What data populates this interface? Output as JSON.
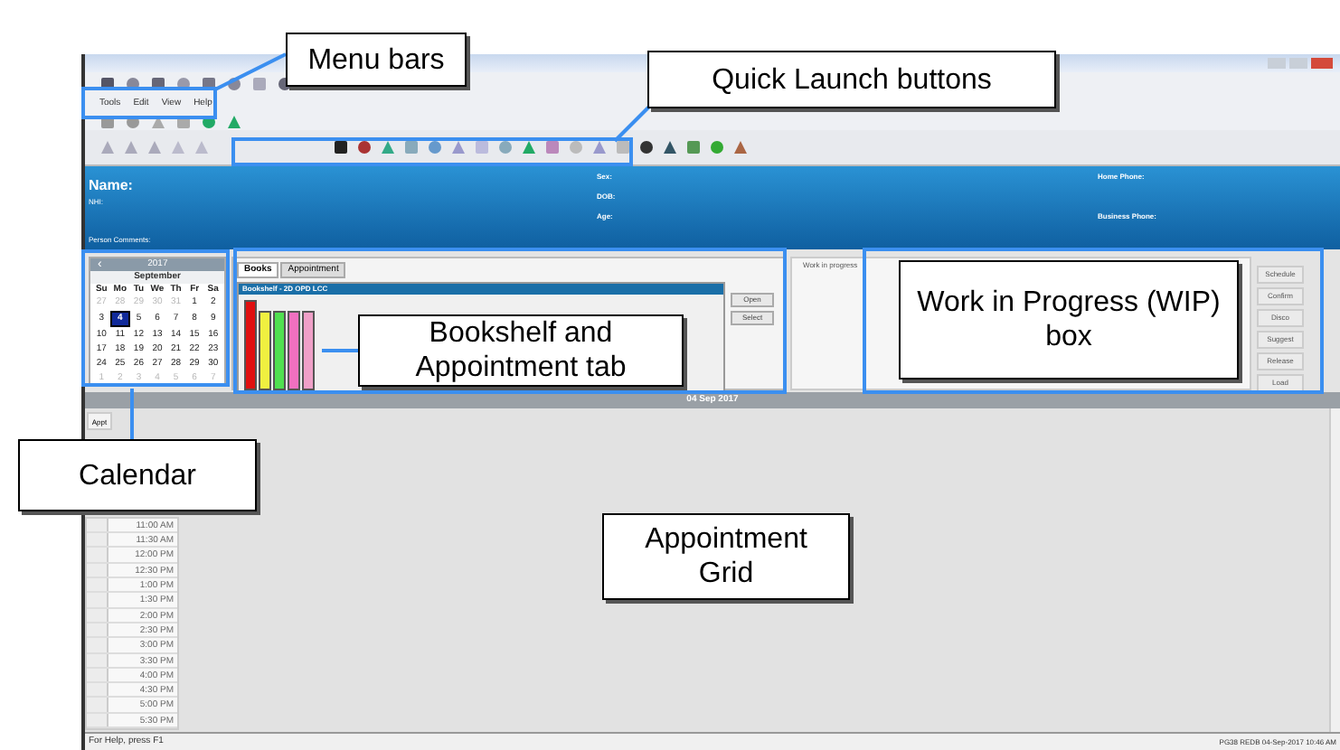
{
  "callouts": [
    {
      "label": "Menu bars"
    },
    {
      "label": "Quick Launch buttons"
    },
    {
      "label": "Bookshelf and Appointment tab"
    },
    {
      "label": "Work in Progress (WIP) box"
    },
    {
      "label": "Calendar"
    },
    {
      "label": "Appointment Grid"
    }
  ],
  "menu": [
    "Tools",
    "Edit",
    "View",
    "Help"
  ],
  "header": {
    "left": [
      "Name:",
      "NHI:"
    ],
    "comments": "Person Comments:",
    "middle": [
      "Sex:",
      "DOB:",
      "Age:"
    ],
    "right": [
      "Home Phone:",
      "Business Phone:"
    ]
  },
  "calendar": {
    "prev_year": "‹",
    "year": "2017",
    "month": "September",
    "weekdays": [
      "Su",
      "Mo",
      "Tu",
      "We",
      "Th",
      "Fr",
      "Sa"
    ],
    "weeks": [
      [
        {
          "day": "27",
          "other_month": true,
          "selected": false
        },
        {
          "day": "28",
          "other_month": true,
          "selected": false
        },
        {
          "day": "29",
          "other_month": true,
          "selected": false
        },
        {
          "day": "30",
          "other_month": true,
          "selected": false
        },
        {
          "day": "31",
          "other_month": true,
          "selected": false
        },
        {
          "day": "1",
          "other_month": false,
          "selected": false
        },
        {
          "day": "2",
          "other_month": false,
          "selected": false
        }
      ],
      [
        {
          "day": "3",
          "other_month": false,
          "selected": false
        },
        {
          "day": "4",
          "other_month": false,
          "selected": true
        },
        {
          "day": "5",
          "other_month": false,
          "selected": false
        },
        {
          "day": "6",
          "other_month": false,
          "selected": false
        },
        {
          "day": "7",
          "other_month": false,
          "selected": false
        },
        {
          "day": "8",
          "other_month": false,
          "selected": false
        },
        {
          "day": "9",
          "other_month": false,
          "selected": false
        }
      ],
      [
        {
          "day": "10",
          "other_month": false,
          "selected": false
        },
        {
          "day": "11",
          "other_month": false,
          "selected": false
        },
        {
          "day": "12",
          "other_month": false,
          "selected": false
        },
        {
          "day": "13",
          "other_month": false,
          "selected": false
        },
        {
          "day": "14",
          "other_month": false,
          "selected": false
        },
        {
          "day": "15",
          "other_month": false,
          "selected": false
        },
        {
          "day": "16",
          "other_month": false,
          "selected": false
        }
      ],
      [
        {
          "day": "17",
          "other_month": false,
          "selected": false
        },
        {
          "day": "18",
          "other_month": false,
          "selected": false
        },
        {
          "day": "19",
          "other_month": false,
          "selected": false
        },
        {
          "day": "20",
          "other_month": false,
          "selected": false
        },
        {
          "day": "21",
          "other_month": false,
          "selected": false
        },
        {
          "day": "22",
          "other_month": false,
          "selected": false
        },
        {
          "day": "23",
          "other_month": false,
          "selected": false
        }
      ],
      [
        {
          "day": "24",
          "other_month": false,
          "selected": false
        },
        {
          "day": "25",
          "other_month": false,
          "selected": false
        },
        {
          "day": "26",
          "other_month": false,
          "selected": false
        },
        {
          "day": "27",
          "other_month": false,
          "selected": false
        },
        {
          "day": "28",
          "other_month": false,
          "selected": false
        },
        {
          "day": "29",
          "other_month": false,
          "selected": false
        },
        {
          "day": "30",
          "other_month": false,
          "selected": false
        }
      ],
      [
        {
          "day": "1",
          "other_month": true,
          "selected": false
        },
        {
          "day": "2",
          "other_month": true,
          "selected": false
        },
        {
          "day": "3",
          "other_month": true,
          "selected": false
        },
        {
          "day": "4",
          "other_month": true,
          "selected": false
        },
        {
          "day": "5",
          "other_month": true,
          "selected": false
        },
        {
          "day": "6",
          "other_month": true,
          "selected": false
        },
        {
          "day": "7",
          "other_month": true,
          "selected": false
        }
      ]
    ]
  },
  "tabs": [
    {
      "label": "Books",
      "selected": true
    },
    {
      "label": "Appointment",
      "selected": false
    }
  ],
  "bookshelf": {
    "title": "Bookshelf - 2D OPD LCC",
    "books": [
      {
        "color": "#e01010"
      },
      {
        "color": "#f0f040"
      },
      {
        "color": "#50e050"
      },
      {
        "color": "#f070c0"
      },
      {
        "color": "#f0a0c8"
      }
    ],
    "buttons": [
      "Open",
      "Select"
    ]
  },
  "wip": {
    "title": "Work in progress"
  },
  "side_buttons": [
    "Schedule",
    "Confirm",
    "Disco",
    "Suggest",
    "Release",
    "Load"
  ],
  "date_bar": "04 Sep 2017",
  "grid": {
    "header": "Appt",
    "times": [
      "11:00 AM",
      "11:30 AM",
      "12:00 PM",
      "12:30 PM",
      "1:00 PM",
      "1:30 PM",
      "2:00 PM",
      "2:30 PM",
      "3:00 PM",
      "3:30 PM",
      "4:00 PM",
      "4:30 PM",
      "5:00 PM",
      "5:30 PM"
    ]
  },
  "status_bar": {
    "help": "For Help, press F1",
    "info": "PG38 REDB 04-Sep-2017 10:46 AM"
  }
}
